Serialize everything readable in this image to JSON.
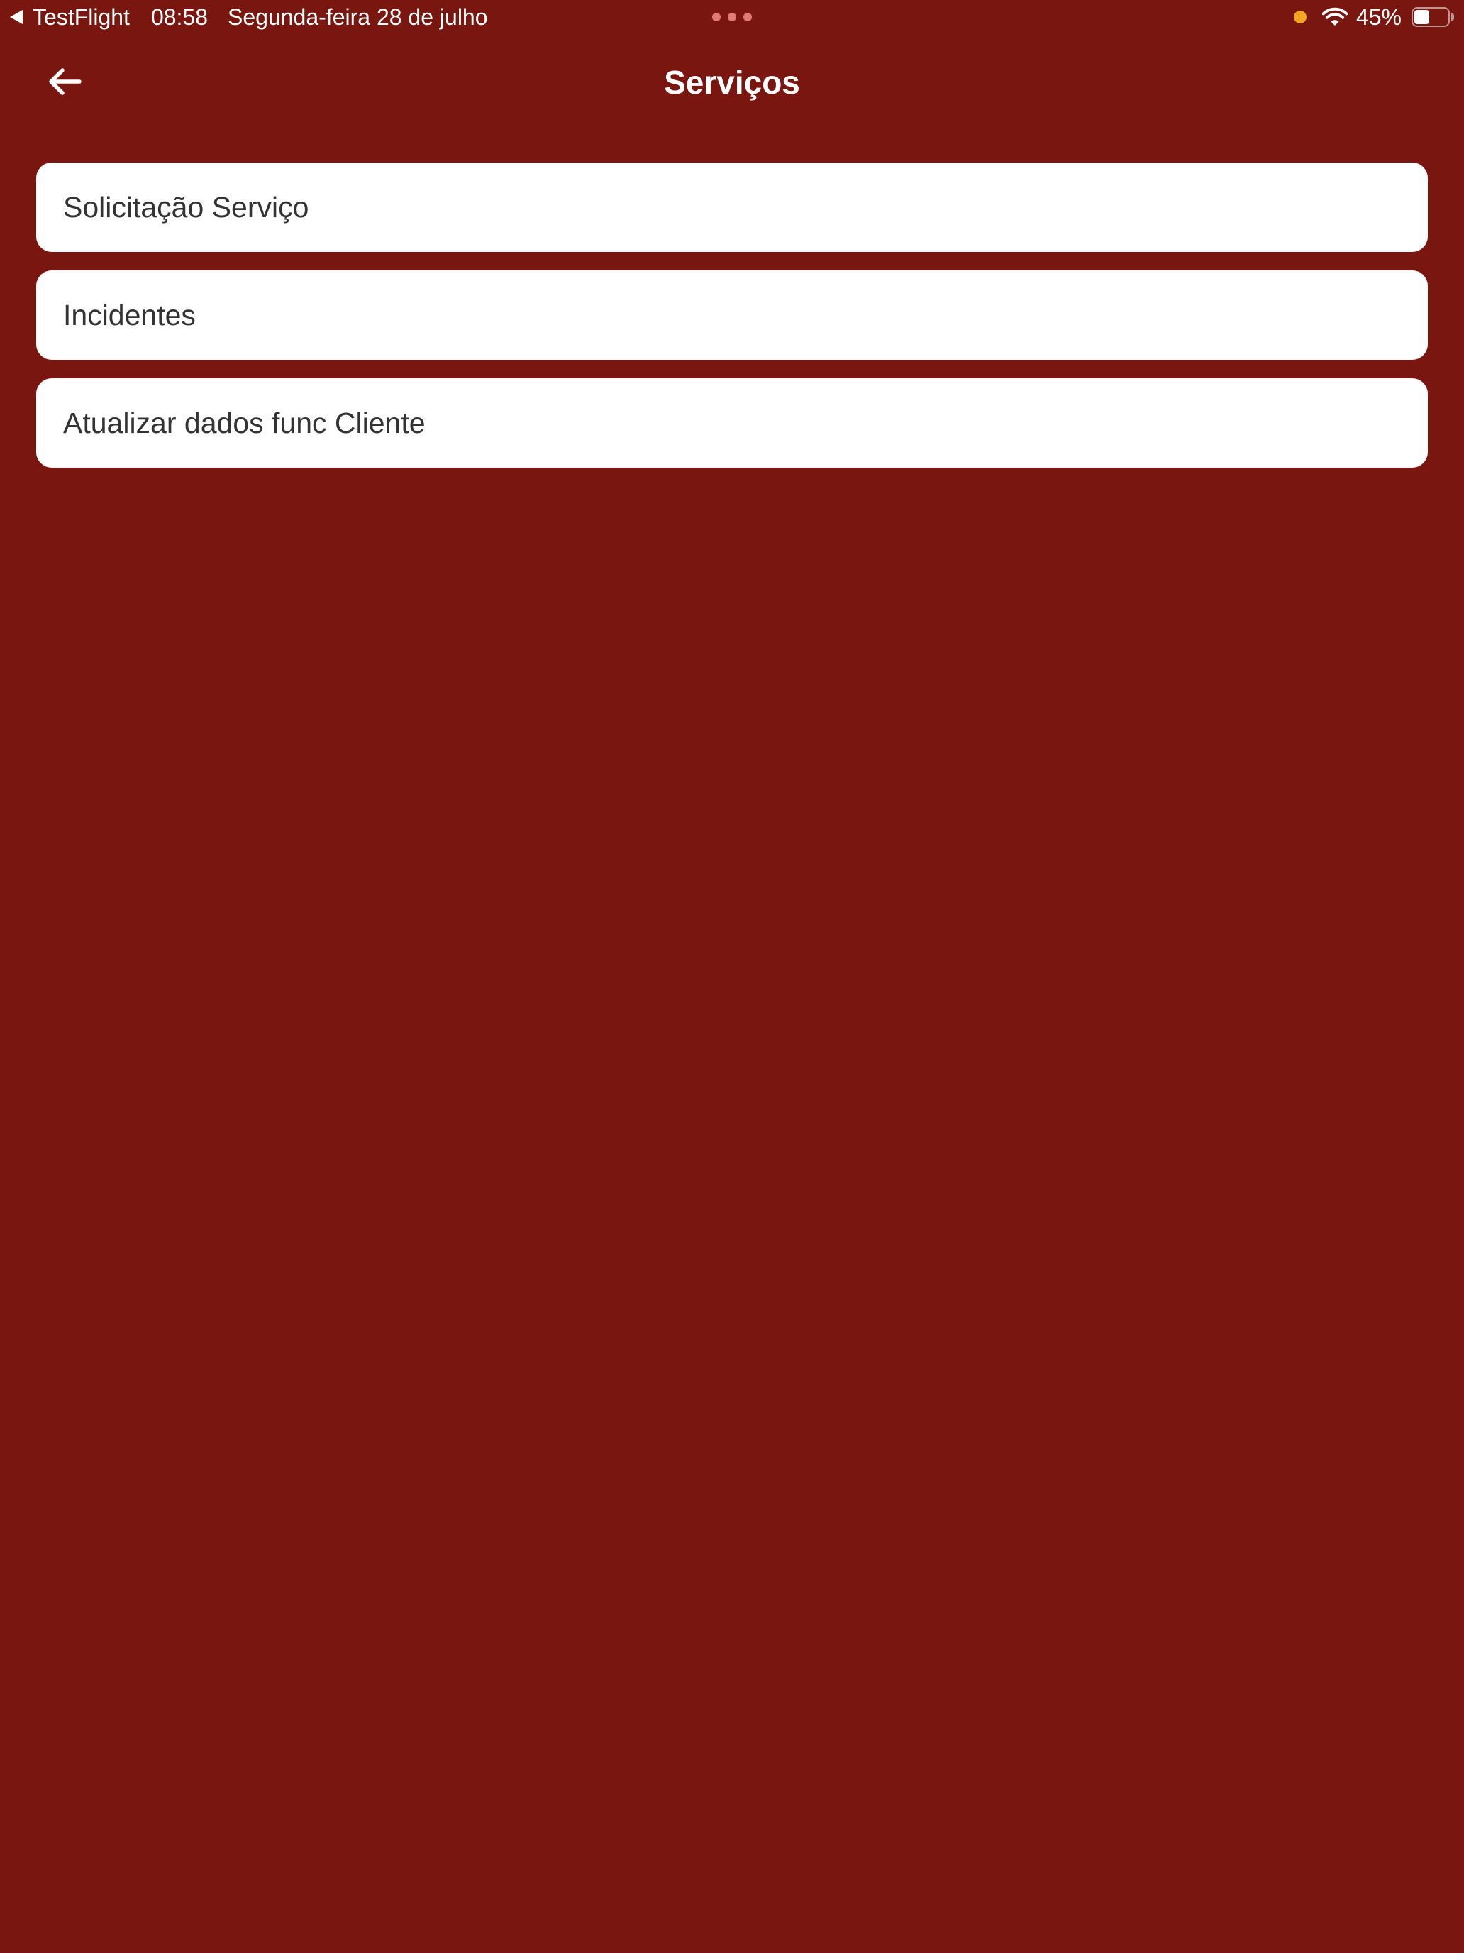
{
  "status_bar": {
    "back_app": "TestFlight",
    "time": "08:58",
    "date": "Segunda-feira 28 de julho",
    "battery_text": "45%",
    "battery_level": 0.45,
    "privacy_indicator_color": "#f5a524",
    "icons": [
      "back-triangle-icon",
      "wifi-icon",
      "battery-icon"
    ]
  },
  "header": {
    "back_icon": "arrow-left-icon",
    "title": "Serviços"
  },
  "menu": {
    "items": [
      {
        "label": "Solicitação Serviço"
      },
      {
        "label": "Incidentes"
      },
      {
        "label": "Atualizar dados func Cliente"
      }
    ]
  },
  "colors": {
    "background": "#7a1610",
    "card": "#ffffff",
    "card_text": "#333333",
    "header_text": "#ffffff"
  }
}
